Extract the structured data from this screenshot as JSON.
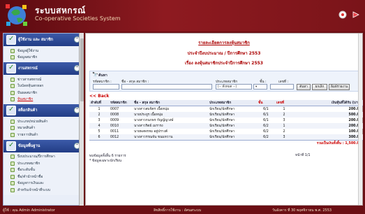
{
  "header": {
    "title": "ระบบสหกรณ์",
    "subtitle": "Co-operative Societies System"
  },
  "sidebar": {
    "groups": [
      {
        "label": "ผู้ใช้งาน และ สมาชิก",
        "items": [
          {
            "label": "ข้อมูลผู้ใช้งาน"
          },
          {
            "label": "ข้อมูลสมาชิก"
          }
        ]
      },
      {
        "label": "งานสหกรณ์",
        "items": [
          {
            "label": "ข่าวสารสหกรณ์"
          },
          {
            "label": "ใบบัลหหุ้นสกหลก"
          },
          {
            "label": "ปันผลสมาชิก"
          },
          {
            "label": "หุ้นสมาชิก"
          }
        ]
      },
      {
        "label": "สต็อกสินค้า",
        "items": [
          {
            "label": "ประเภท/หน่วยสินค้า"
          },
          {
            "label": "หมวดสินค้า"
          },
          {
            "label": "รายการสินค้า"
          }
        ]
      },
      {
        "label": "ข้อมูลพื้นฐาน",
        "items": [
          {
            "label": "ปีงบประมาณ/ปีการศึกษา"
          },
          {
            "label": "ประเภทสมาชิก"
          },
          {
            "label": "ชื่อระดับชั้น"
          },
          {
            "label": "ชื่อ/คำนำหน้าชื่อ"
          },
          {
            "label": "ข้อมูลการเงินและ"
          },
          {
            "label": "สำหรับเจ้าหน้าที่ระบบ"
          }
        ]
      }
    ]
  },
  "main": {
    "title1": "รายละเอียดการลงหุ้นสมาชิก",
    "title2": "ประจำปีงบประมาณ / ปีการศึกษา 2553",
    "title3": "เรื่อง ลงหุ้นสมาชิกประจำปีการศึกษา 2553",
    "search": {
      "label": "ค้นหา",
      "field_code": "รหัสสมาชิก :",
      "field_name": "ชื่อ - สกุล สมาชิก :",
      "field_type": "ประเภทสมาชิก",
      "field_class": "ชั้น :",
      "field_no": "เลขที่ :",
      "type_value": "[-- ทั้งหมด --]",
      "btn_search": "ค้นหา",
      "btn_cancel": "ยกเลิก",
      "btn_print": "พิมพ์รายงาน"
    },
    "back_label": "<< Back",
    "table": {
      "headers": [
        "ลำดับที่",
        "รหัสสมาชิก",
        "ชื่อ - สกุล สมาชิก",
        "ประเภทสมาชิก",
        "ชั้น",
        "เลขที่",
        "เงินหุ้นที่ได้รับ (บาท)"
      ],
      "rows": [
        [
          "1",
          "0007",
          "นางสาวสมจิตร เนื้อหนุ่ม",
          "นักเรียน/นักศึกษา",
          "6/1",
          "1",
          "200.00"
        ],
        [
          "2",
          "0008",
          "นายประยูร เนื้อหนุ่ม",
          "นักเรียน/นักศึกษา",
          "6/1",
          "2",
          "500.00"
        ],
        [
          "3",
          "0009",
          "นางสาวกนกพร กัญญ์ญวงษ์",
          "นักเรียน/นักศึกษา",
          "6/1",
          "3",
          "200.00"
        ],
        [
          "4",
          "0010",
          "นางสาวริตย์ เมรารง",
          "นักเรียน/นักศึกษา",
          "6/2",
          "1",
          "200.00"
        ],
        [
          "5",
          "0011",
          "นายพลพรหม อยู่ปรางค์",
          "นักเรียน/นักศึกษา",
          "6/2",
          "2",
          "100.00"
        ],
        [
          "6",
          "0012",
          "นางสาวรรณจัน ขนมหวาน",
          "นักเรียน/นักศึกษา",
          "6/2",
          "3",
          "300.00"
        ]
      ],
      "total": "รวมเป็นเงินทั้งสิ้น : 1,500.00"
    },
    "footer_count": "พบข้อมูลทั้งสิ้น 6 รายการ",
    "footer_note": "* ข้อมูลเฉพาะนักเรียน",
    "pager": "หน้าที่ 1/1"
  },
  "footer": {
    "user": "ผู้ใช้ : คุณ Admin Administrator",
    "copyright": "ลิขสิทธิ์การใช้งาน : อัศนสระบบ",
    "date": "วันอังคาร ที่ 30 พฤศจิกายน พ.ศ. 2553"
  }
}
